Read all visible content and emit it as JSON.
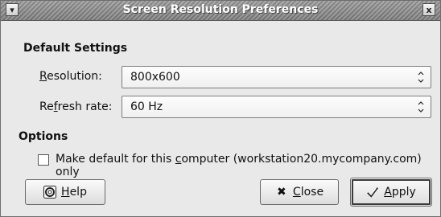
{
  "window": {
    "title": "Screen Resolution Preferences",
    "menu_icon": "chevron-down-icon",
    "close_glyph": "x"
  },
  "default_settings": {
    "heading": "Default Settings",
    "resolution": {
      "label_prefix": "",
      "label_accel": "R",
      "label_rest": "esolution:",
      "value": "800x600"
    },
    "refresh": {
      "label_prefix": "Re",
      "label_accel": "f",
      "label_rest": "resh rate:",
      "value": "60 Hz"
    }
  },
  "options": {
    "heading": "Options",
    "make_default": {
      "checked": false,
      "label_prefix": "Make default for this ",
      "label_accel": "c",
      "label_rest": "omputer (workstation20.mycompany.com) only"
    }
  },
  "buttons": {
    "help": {
      "accel": "H",
      "rest": "elp",
      "icon": "help-icon"
    },
    "close": {
      "accel": "C",
      "rest": "lose",
      "icon": "close-icon"
    },
    "apply": {
      "accel": "A",
      "rest": "pply",
      "icon": "apply-check-icon"
    }
  }
}
